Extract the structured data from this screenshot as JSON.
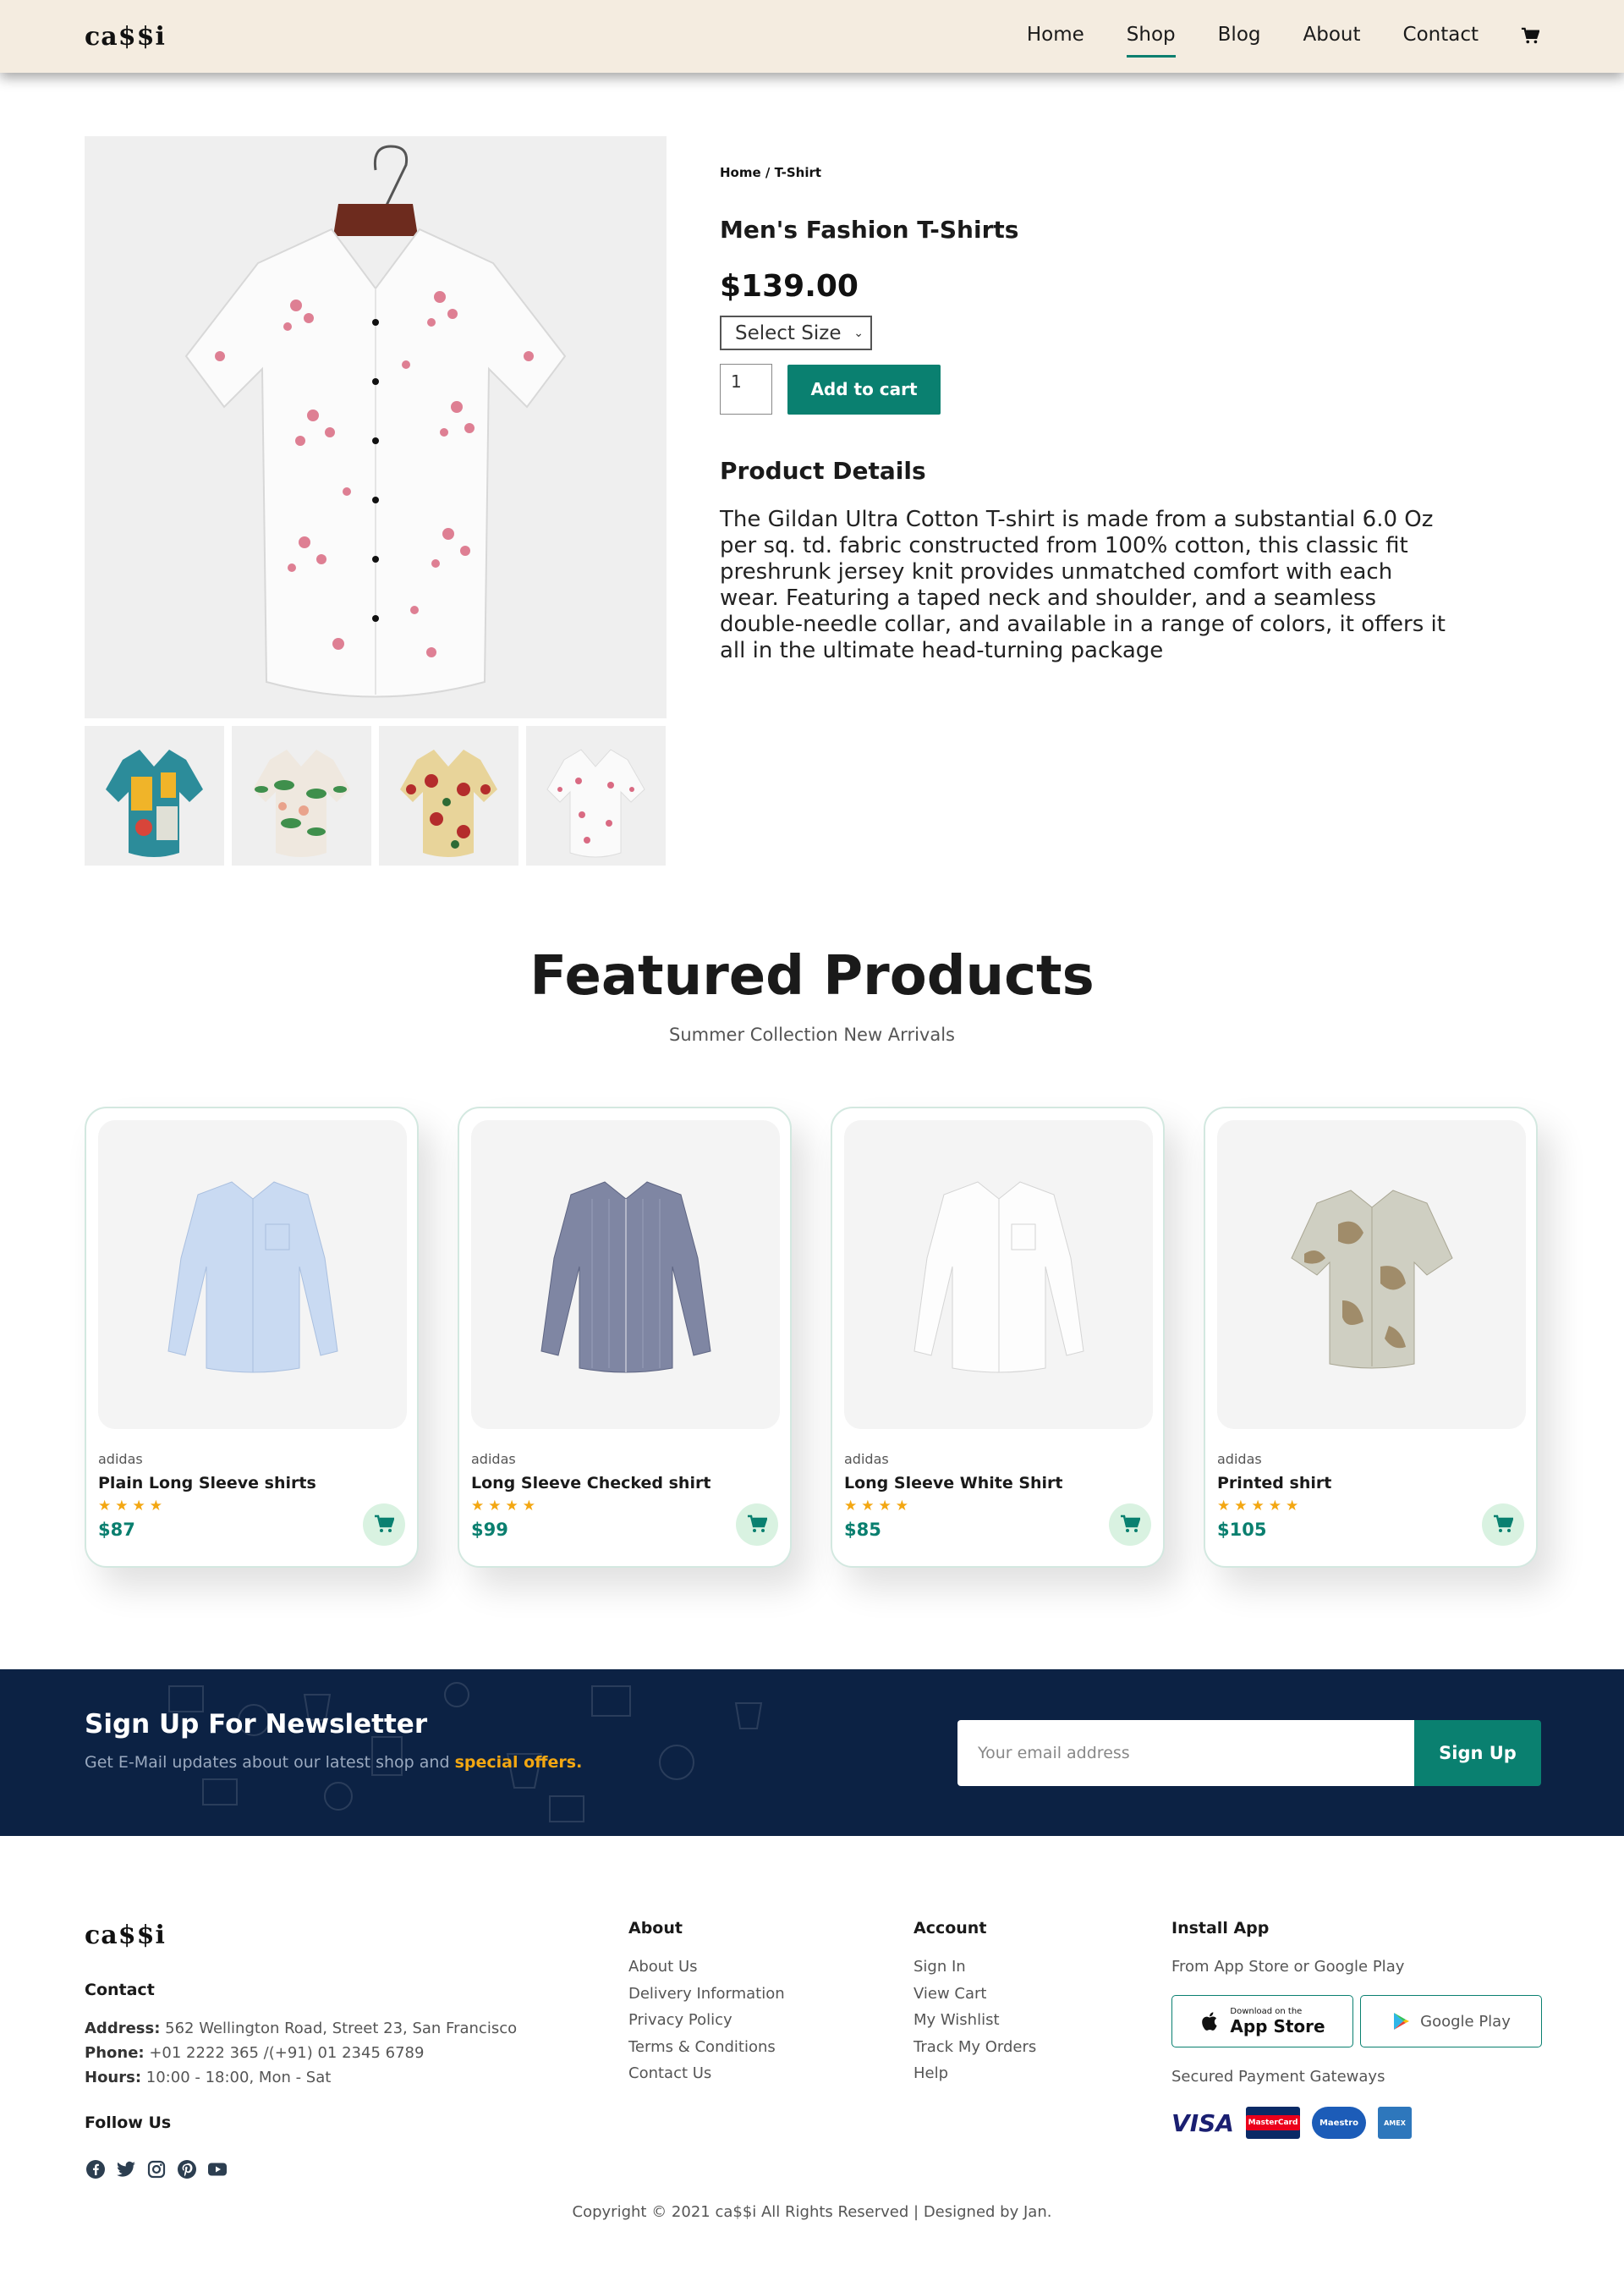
{
  "header": {
    "logo": "ca$$i",
    "nav": [
      {
        "label": "Home"
      },
      {
        "label": "Shop",
        "active": true
      },
      {
        "label": "Blog"
      },
      {
        "label": "About"
      },
      {
        "label": "Contact"
      }
    ],
    "cart_icon": "shopping-cart-icon"
  },
  "product": {
    "breadcrumb": "Home / T-Shirt",
    "title": "Men's Fashion T-Shirts",
    "price": "$139.00",
    "size_select": "Select Size",
    "quantity": "1",
    "add_to_cart": "Add to cart",
    "details_heading": "Product Details",
    "details_body": "The Gildan Ultra Cotton T-shirt is made from a substantial 6.0 Oz per sq. td. fabric constructed from 100% cotton, this classic fit preshrunk jersey knit provides unmatched comfort with each wear. Featuring a taped neck and shoulder, and a seamless double-needle collar, and available in a range of colors, it offers it all in the ultimate head-turning package"
  },
  "featured": {
    "title": "Featured Products",
    "subtitle": "Summer Collection New Arrivals",
    "products": [
      {
        "brand": "adidas",
        "name": "Plain Long Sleeve shirts",
        "rating": 4,
        "price": "$87"
      },
      {
        "brand": "adidas",
        "name": "Long Sleeve Checked shirt",
        "rating": 4,
        "price": "$99"
      },
      {
        "brand": "adidas",
        "name": "Long Sleeve White Shirt",
        "rating": 4,
        "price": "$85"
      },
      {
        "brand": "adidas",
        "name": "Printed shirt",
        "rating": 5,
        "price": "$105"
      }
    ]
  },
  "newsletter": {
    "title": "Sign Up For Newsletter",
    "text": "Get E-Mail updates about our latest shop and",
    "highlight": "special offers.",
    "placeholder": "Your email address",
    "button": "Sign Up"
  },
  "footer": {
    "logo": "ca$$i",
    "contact_heading": "Contact",
    "address_label": "Address:",
    "address": "562 Wellington Road, Street 23, San Francisco",
    "phone_label": "Phone:",
    "phone": "+01 2222 365 /(+91) 01 2345 6789",
    "hours_label": "Hours:",
    "hours": "10:00 - 18:00, Mon - Sat",
    "follow_heading": "Follow Us",
    "about_heading": "About",
    "about_links": [
      "About Us",
      "Delivery Information",
      "Privacy Policy",
      "Terms & Conditions",
      "Contact Us"
    ],
    "account_heading": "Account",
    "account_links": [
      "Sign In",
      "View Cart",
      "My Wishlist",
      "Track My Orders",
      "Help"
    ],
    "install_heading": "Install App",
    "install_text": "From App Store or Google Play",
    "app_store_small": "Download on the",
    "app_store_big": "App Store",
    "google_play": "Google Play",
    "payment_heading": "Secured Payment Gateways",
    "payments": [
      "VISA",
      "MasterCard",
      "Maestro",
      "AMEX"
    ],
    "copyright": "Copyright © 2021 ca$$i All Rights Reserved | Designed by Jan."
  },
  "colors": {
    "accent": "#0a8070",
    "header_bg": "#f4ece0",
    "newsletter_bg": "#0c2244",
    "star": "#f3a712"
  }
}
